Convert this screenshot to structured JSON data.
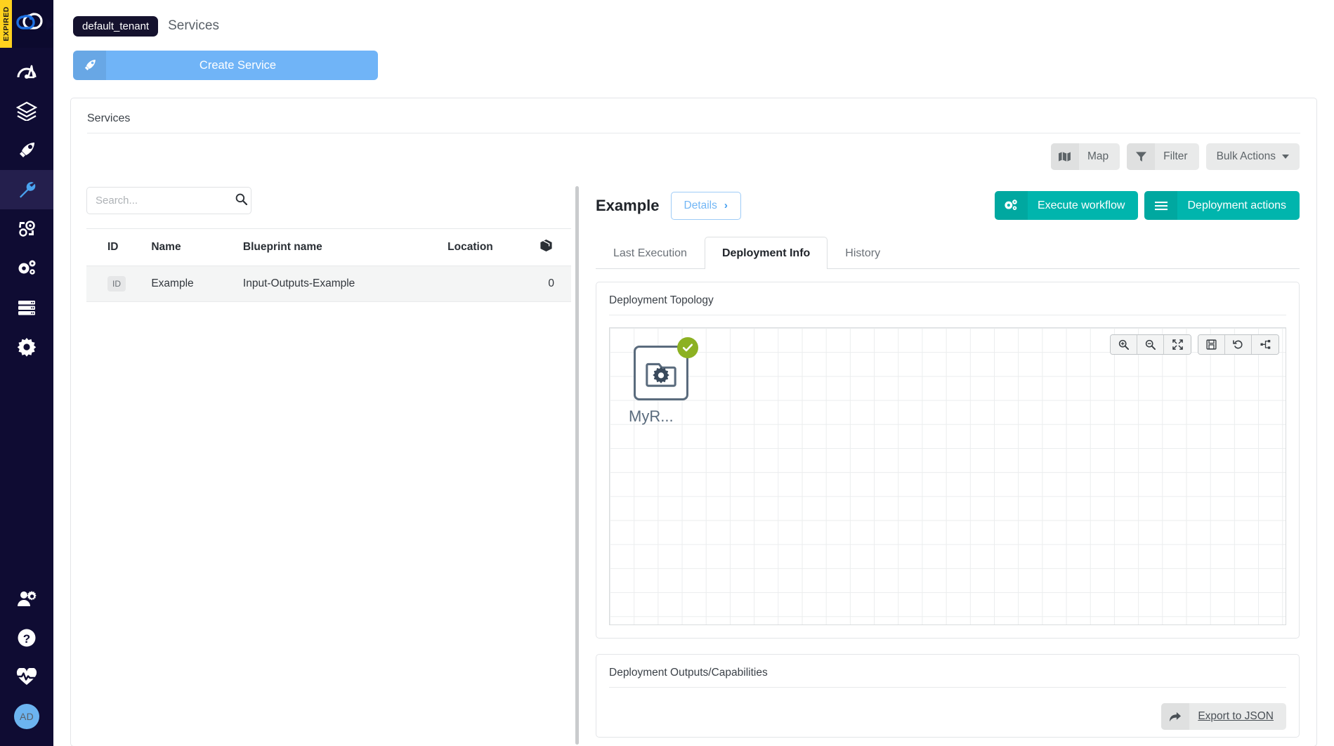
{
  "sidebar": {
    "expired_label": "EXPIRED",
    "logo_name": "cloudify-logo",
    "items": [
      {
        "name": "dashboard",
        "icon": "gauge-icon"
      },
      {
        "name": "blueprints",
        "icon": "layers-icon"
      },
      {
        "name": "deployments",
        "icon": "rocket-icon"
      },
      {
        "name": "services",
        "icon": "wrench-icon",
        "active": true
      },
      {
        "name": "executions",
        "icon": "cogs-cycle-icon"
      },
      {
        "name": "plugins",
        "icon": "double-gear-icon"
      },
      {
        "name": "catalog",
        "icon": "server-icon"
      },
      {
        "name": "system-settings",
        "icon": "gear-icon"
      }
    ],
    "bottom_items": [
      {
        "name": "user-management",
        "icon": "user-gear-icon"
      },
      {
        "name": "help",
        "icon": "question-circle-icon"
      },
      {
        "name": "health",
        "icon": "heartbeat-icon"
      }
    ],
    "avatar_initials": "AD"
  },
  "topbar": {
    "tenant": "default_tenant",
    "page_title": "Services"
  },
  "create_service": {
    "label": "Create Service",
    "icon": "rocket-icon"
  },
  "panel": {
    "title": "Services"
  },
  "toolbar": {
    "map_label": "Map",
    "map_icon": "map-icon",
    "filter_label": "Filter",
    "filter_icon": "funnel-icon",
    "bulk_actions_label": "Bulk Actions"
  },
  "search": {
    "value": "",
    "placeholder": "Search...",
    "icon": "search-icon"
  },
  "table": {
    "columns": [
      "ID",
      "Name",
      "Blueprint name",
      "Location",
      "box-icon"
    ],
    "rows": [
      {
        "id": "ID",
        "name": "Example",
        "blueprint_name": "Input-Outputs-Example",
        "location": "",
        "count": "0"
      }
    ]
  },
  "deployment": {
    "name": "Example",
    "details_label": "Details",
    "details_chevron": "›",
    "execute_workflow_label": "Execute workflow",
    "execute_workflow_icon": "cogs-icon",
    "deployment_actions_label": "Deployment actions",
    "deployment_actions_icon": "hamburger-icon",
    "tabs": [
      {
        "label": "Last Execution",
        "active": false
      },
      {
        "label": "Deployment Info",
        "active": true
      },
      {
        "label": "History",
        "active": false
      }
    ]
  },
  "topology": {
    "title": "Deployment Topology",
    "node_label": "MyR...",
    "node_icon": "folder-gear-icon",
    "node_status": "ok",
    "tools": [
      {
        "name": "zoom-in-icon"
      },
      {
        "name": "zoom-out-icon"
      },
      {
        "name": "fit-to-screen-icon"
      },
      {
        "name": "save-icon"
      },
      {
        "name": "reset-icon"
      },
      {
        "name": "expand-hierarchy-icon"
      }
    ]
  },
  "outputs": {
    "title": "Deployment Outputs/Capabilities",
    "export_label": "Export to JSON",
    "export_icon": "share-icon"
  },
  "colors": {
    "sidebar_bg": "#0f0c33",
    "expired_badge": "#ffd21e",
    "primary_blue": "#70b4f7",
    "teal": "#00b5ad",
    "status_green": "#8cb122"
  }
}
